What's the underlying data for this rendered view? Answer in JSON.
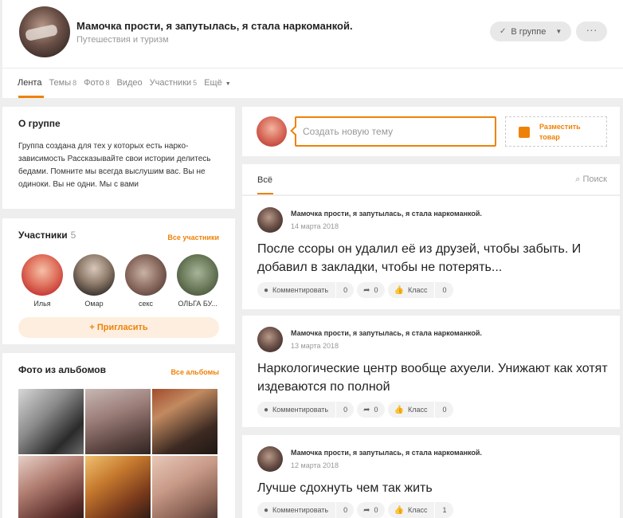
{
  "header": {
    "group_name": "Мамочка прости, я запутылась, я стала наркоманкой.",
    "category": "Путешествия и туризм",
    "in_group_label": "В группе",
    "more_label": "···"
  },
  "nav": {
    "items": [
      {
        "label": "Лента",
        "count": ""
      },
      {
        "label": "Темы",
        "count": "8"
      },
      {
        "label": "Фото",
        "count": "8"
      },
      {
        "label": "Видео",
        "count": ""
      },
      {
        "label": "Участники",
        "count": "5"
      },
      {
        "label": "Ещё",
        "count": ""
      }
    ]
  },
  "about": {
    "title": "О группе",
    "text": "Группа создана для тех у которых есть нарко­зависимость Рассказывайте свои истории делитесь бедами. Помните мы всегда выслушим вас. Вы не одиноки. Вы не одни. Мы с вами"
  },
  "members": {
    "title": "Участники",
    "count": "5",
    "all_link": "Все участники",
    "list": [
      {
        "name": "Илья"
      },
      {
        "name": "Омар"
      },
      {
        "name": "секс"
      },
      {
        "name": "ОЛЬГА БУ..."
      }
    ],
    "invite_label": "Пригласить"
  },
  "photos": {
    "title": "Фото из альбомов",
    "all_link": "Все альбомы"
  },
  "composer": {
    "placeholder": "Создать новую тему",
    "sell_label_1": "Разместить",
    "sell_label_2": "товар"
  },
  "feed": {
    "tab_all": "Всё",
    "search_label": "Поиск",
    "posts": [
      {
        "author": "Мамочка прости, я запутылась, я стала наркоманкой.",
        "date": "14 марта 2018",
        "text": "После ссоры он удалил её из друзей, чтобы забыть. И добавил в закладки, чтобы не потерять...",
        "comment_label": "Комментировать",
        "comments": "0",
        "shares": "0",
        "like_label": "Класс",
        "likes": "0"
      },
      {
        "author": "Мамочка прости, я запутылась, я стала наркоманкой.",
        "date": "13 марта 2018",
        "text": "Наркологические центр вообще ахуели. Унижают как хотят издеваются по полной",
        "comment_label": "Комментировать",
        "comments": "0",
        "shares": "0",
        "like_label": "Класс",
        "likes": "0"
      },
      {
        "author": "Мамочка прости, я запутылась, я стала наркоманкой.",
        "date": "12 марта 2018",
        "text": "Лучше сдохнуть чем так жить",
        "comment_label": "Комментировать",
        "comments": "0",
        "shares": "0",
        "like_label": "Класс",
        "likes": "1"
      }
    ]
  },
  "colors": {
    "accent": "#ee8208",
    "background": "#eeeeee"
  }
}
